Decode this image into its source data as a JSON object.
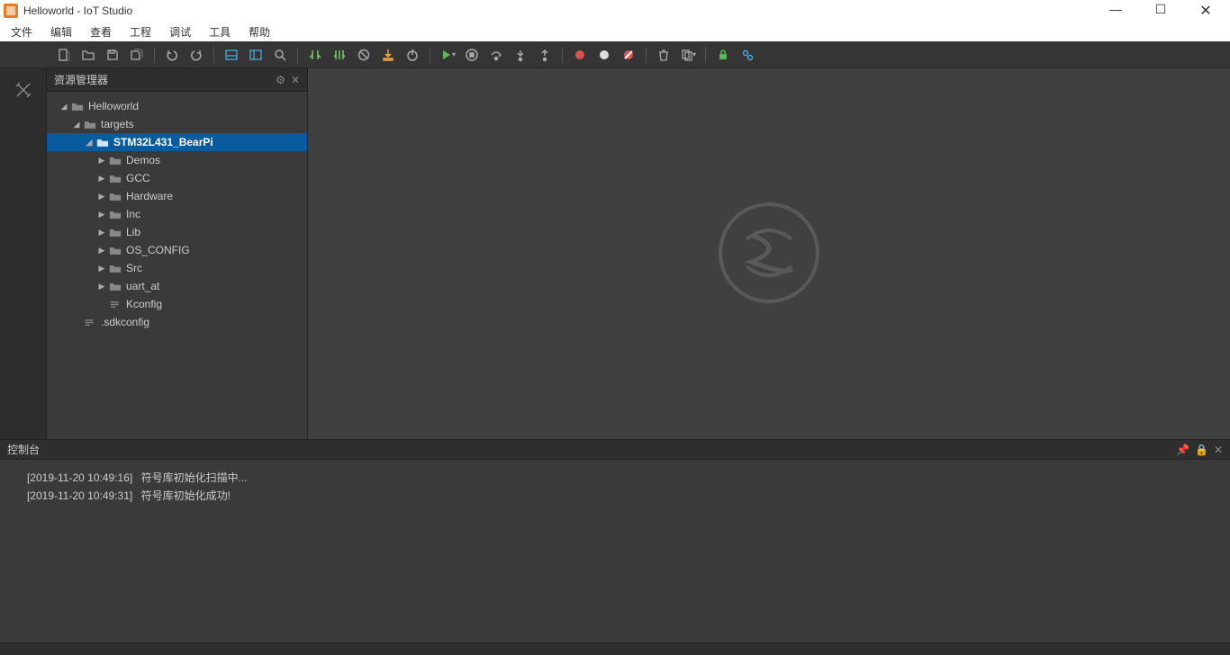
{
  "window": {
    "title": "Helloworld - IoT Studio"
  },
  "menu": {
    "file": "文件",
    "edit": "编辑",
    "view": "查看",
    "project": "工程",
    "debug": "调试",
    "tools": "工具",
    "help": "帮助"
  },
  "panel": {
    "explorer_title": "资源管理器",
    "console_title": "控制台"
  },
  "tree": {
    "root": "Helloworld",
    "targets": "targets",
    "stm32": "STM32L431_BearPi",
    "demos": "Demos",
    "gcc": "GCC",
    "hardware": "Hardware",
    "inc": "Inc",
    "lib": "Lib",
    "osconfig": "OS_CONFIG",
    "src": "Src",
    "uart": "uart_at",
    "kconfig": "Kconfig",
    "sdkconfig": ".sdkconfig"
  },
  "console": {
    "logs": [
      {
        "ts": "[2019-11-20  10:49:16]",
        "msg": "符号库初始化扫描中..."
      },
      {
        "ts": "[2019-11-20  10:49:31]",
        "msg": "符号库初始化成功!"
      }
    ]
  }
}
